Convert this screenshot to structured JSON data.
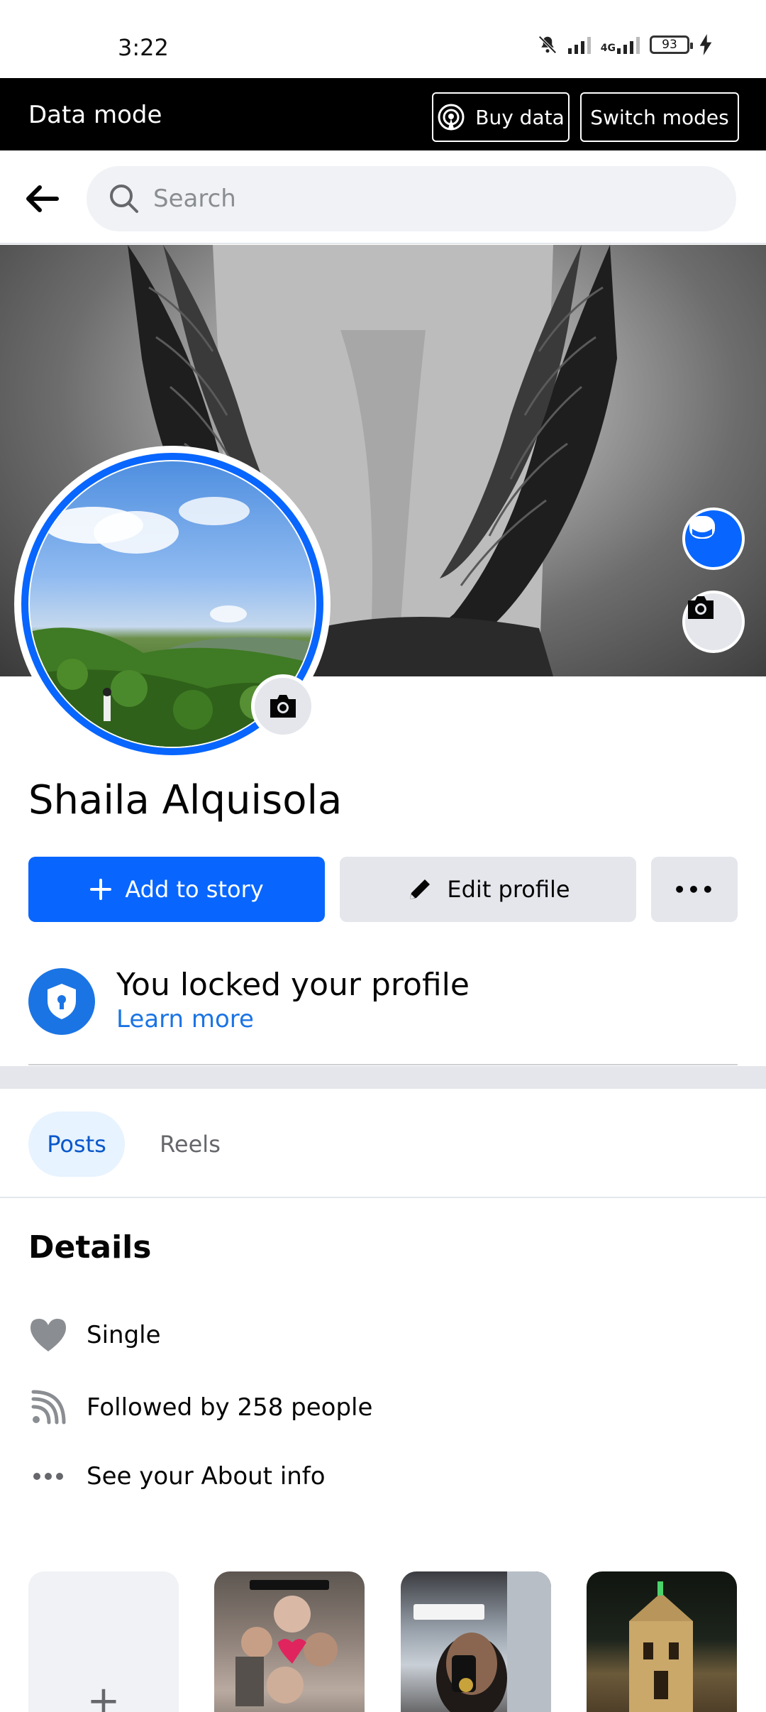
{
  "status_bar": {
    "time": "3:22",
    "network": "4G",
    "battery": "93",
    "icons": [
      "mute-bell-icon",
      "signal-icon",
      "4g-signal-icon",
      "battery-icon",
      "charging-icon"
    ]
  },
  "data_mode": {
    "title": "Data mode",
    "buy_label": "Buy data",
    "switch_label": "Switch modes"
  },
  "search": {
    "placeholder": "Search"
  },
  "profile": {
    "name": "Shaila Alquisola",
    "add_story_label": "Add to story",
    "edit_profile_label": "Edit profile",
    "more_label": "•••"
  },
  "lock_notice": {
    "title": "You locked your profile",
    "link": "Learn more"
  },
  "tabs": {
    "posts": "Posts",
    "reels": "Reels"
  },
  "details": {
    "title": "Details",
    "relationship": "Single",
    "followers": "Followed by 258 people",
    "about": "See your About info"
  },
  "stories": {
    "add_symbol": "+"
  },
  "colors": {
    "accent": "#0866ff",
    "link": "#1b74e4",
    "tab_active_bg": "#e7f3ff",
    "button_secondary": "#e4e6eb"
  }
}
